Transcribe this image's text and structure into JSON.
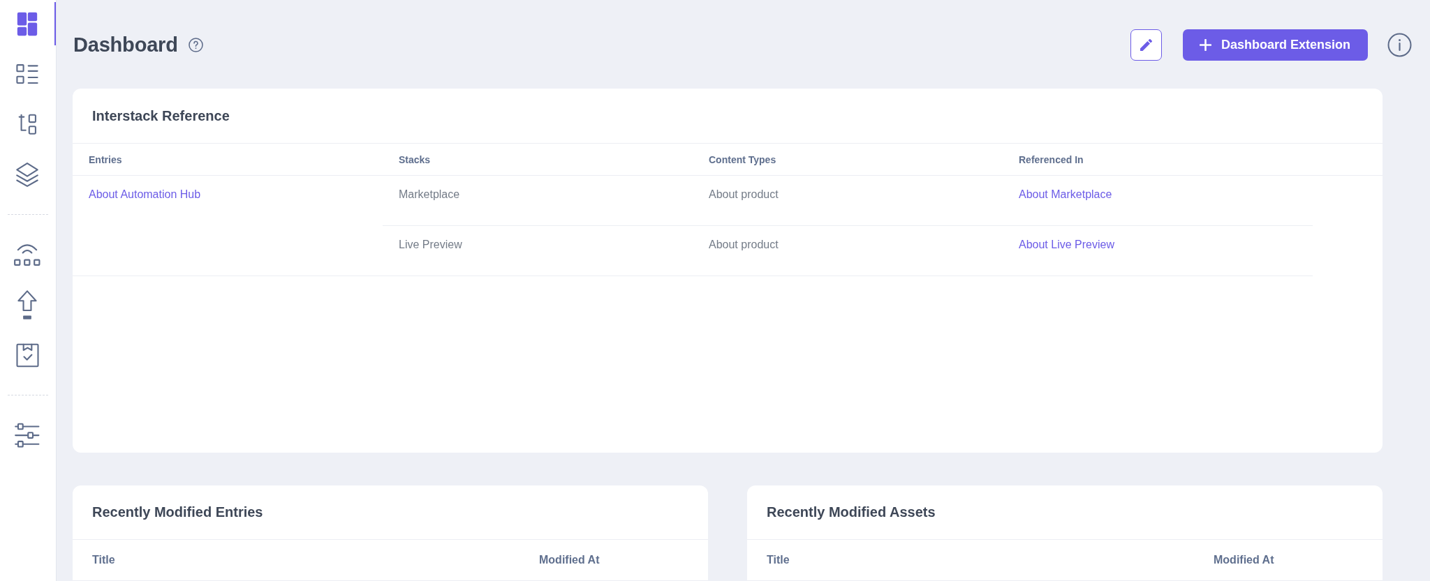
{
  "sidebar": {
    "groups": [
      {
        "items": [
          {
            "kind": "grid",
            "selected": true
          },
          {
            "kind": "list",
            "selected": false
          },
          {
            "kind": "tree",
            "selected": false
          },
          {
            "kind": "layers",
            "selected": false
          }
        ]
      },
      {
        "items": [
          {
            "kind": "signal",
            "selected": false
          },
          {
            "kind": "upload",
            "selected": false
          },
          {
            "kind": "clipboard",
            "selected": false
          }
        ]
      },
      {
        "items": [
          {
            "kind": "sliders",
            "selected": false
          }
        ]
      }
    ]
  },
  "header": {
    "title": "Dashboard",
    "add_button": {
      "label": "Dashboard Extension"
    }
  },
  "interstack_reference": {
    "title": "Interstack Reference",
    "columns": [
      "Entries",
      "Stacks",
      "Content Types",
      "Referenced In"
    ],
    "rows": [
      {
        "entry": "About Automation Hub",
        "references": [
          {
            "stack": "Marketplace",
            "content_type": "About product",
            "referenced_in": "About Marketplace"
          },
          {
            "stack": "Live Preview",
            "content_type": "About product",
            "referenced_in": "About Live Preview"
          }
        ]
      }
    ]
  },
  "panels": [
    {
      "title": "Recently Modified Entries",
      "columns": [
        "Title",
        "Modified At"
      ]
    },
    {
      "title": "Recently Modified Assets",
      "columns": [
        "Title",
        "Modified At"
      ]
    }
  ]
}
